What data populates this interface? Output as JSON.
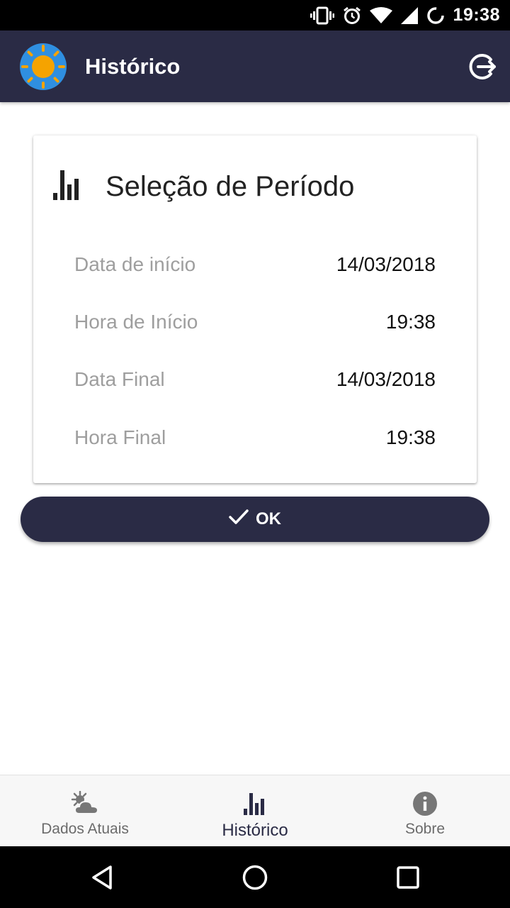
{
  "status_bar": {
    "time": "19:38",
    "icons": [
      "vibrate-icon",
      "alarm-icon",
      "wifi-icon",
      "signal-icon",
      "sync-icon"
    ]
  },
  "app_bar": {
    "title": "Histórico",
    "logo_icon": "sun-logo-icon",
    "action_icon": "logout-icon",
    "background": "#2a2b45"
  },
  "card": {
    "title": "Seleção de Período",
    "title_icon": "bar-chart-icon",
    "rows": [
      {
        "label": "Data de início",
        "value": "14/03/2018"
      },
      {
        "label": "Hora de Início",
        "value": "19:38"
      },
      {
        "label": "Data Final",
        "value": "14/03/2018"
      },
      {
        "label": "Hora Final",
        "value": "19:38"
      }
    ]
  },
  "ok_button": {
    "label": "OK",
    "icon": "check-icon"
  },
  "bottom_nav": {
    "items": [
      {
        "label": "Dados Atuais",
        "icon": "partly-cloudy-icon",
        "active": false
      },
      {
        "label": "Histórico",
        "icon": "bar-chart-icon",
        "active": true
      },
      {
        "label": "Sobre",
        "icon": "info-icon",
        "active": false
      }
    ]
  },
  "system_nav": {
    "buttons": [
      "back-icon",
      "home-icon",
      "recents-icon"
    ]
  },
  "colors": {
    "primary": "#2a2b45",
    "logo_blue": "#2f8fe0",
    "logo_orange": "#f5a300"
  }
}
